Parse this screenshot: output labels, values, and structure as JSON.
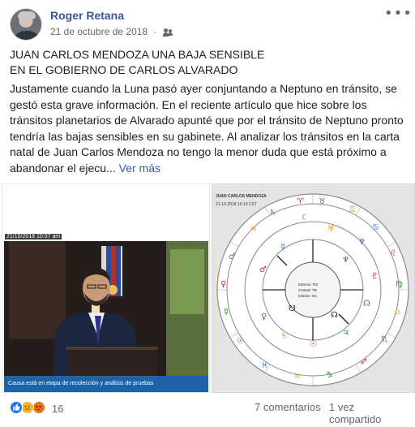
{
  "post": {
    "author": "Roger Retana",
    "date": "21 de octubre de 2018",
    "separator": "·",
    "title_line1": "JUAN CARLOS MENDOZA UNA BAJA SENSIBLE",
    "title_line2": "EN EL GOBIERNO DE CARLOS ALVARADO",
    "body": "Justamente cuando la Luna pasó ayer conjuntando a Neptuno en tránsito, se gestó esta grave información. En el reciente artículo que hice sobre los tránsitos planetarios de Alvarado apunté que por el tránsito de Neptuno pronto tendría las bajas sensibles en su gabinete. Al analizar los tránsitos en la carta natal de Juan Carlos Mendoza no tengo la menor duda que está próximo a abandonar el ejecu...",
    "see_more": "Ver más",
    "more_options": "•••"
  },
  "media": {
    "left": {
      "timestamp": "21/10/2018 10:07 am",
      "caption": "Causa está en etapa de recolección y análisis de pruebas"
    },
    "right": {
      "chart_title": "JUAN CARLOS MENDOZA",
      "chart_date": "21-10-2018 10:19 CST",
      "center_lines": [
        "Exterior: RX",
        "Central: TR",
        "Interior: NA"
      ]
    }
  },
  "footer": {
    "reaction_count": "16",
    "comments": "7 comentarios",
    "shares": "1 vez compartido"
  },
  "colors": {
    "link": "#385898",
    "like": "#1877f2",
    "sad": "#f7b125",
    "angry": "#e9710f",
    "caption_bar": "#1d63a8"
  }
}
